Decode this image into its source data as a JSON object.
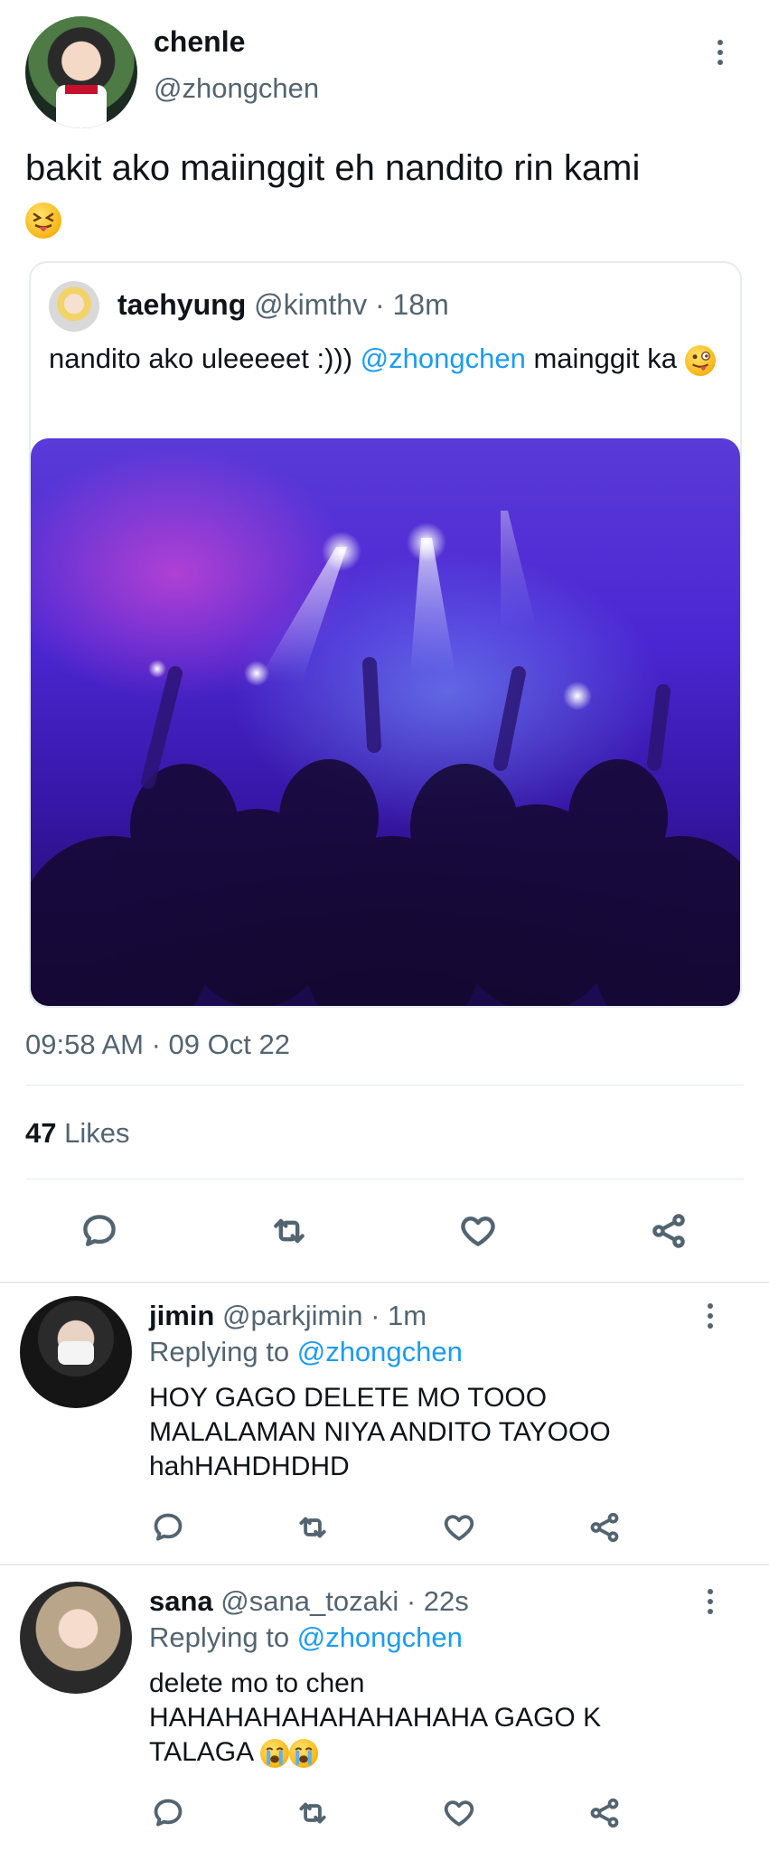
{
  "tweet": {
    "author_name": "chenle",
    "author_handle": "@zhongchen",
    "text": "bakit ako maiinggit eh nandito rin kami",
    "timestamp": "09:58 AM · 09 Oct 22",
    "likes_count": "47",
    "likes_label": "Likes"
  },
  "quote": {
    "author_name": "taehyung",
    "author_handle": "@kimthv",
    "time": "· 18m",
    "text_before": "nandito ako uleeeeet :))) ",
    "mention": "@zhongchen",
    "text_after": " mainggit ka"
  },
  "replies": [
    {
      "name": "jimin",
      "handle": "@parkjimin",
      "time": "· 1m",
      "replying_label": "Replying to",
      "replying_to": "@zhongchen",
      "text": "HOY GAGO DELETE MO TOOO MALALAMAN NIYA ANDITO TAYOOO hahHAHDHDHD"
    },
    {
      "name": "sana",
      "handle": "@sana_tozaki",
      "time": "· 22s",
      "replying_label": "Replying to",
      "replying_to": "@zhongchen",
      "text": "delete mo to chen HAHAHAHAHAHAHAHAHA GAGO K TALAGA"
    }
  ],
  "icons": {
    "reply": "comment-icon",
    "retweet": "retweet-icon",
    "like": "heart-icon",
    "share": "share-icon",
    "more": "more-vertical-icon"
  },
  "colors": {
    "link": "#1d9bf0",
    "muted": "#536471",
    "text": "#0f1419",
    "concert_purple": "#4a1fc9"
  }
}
